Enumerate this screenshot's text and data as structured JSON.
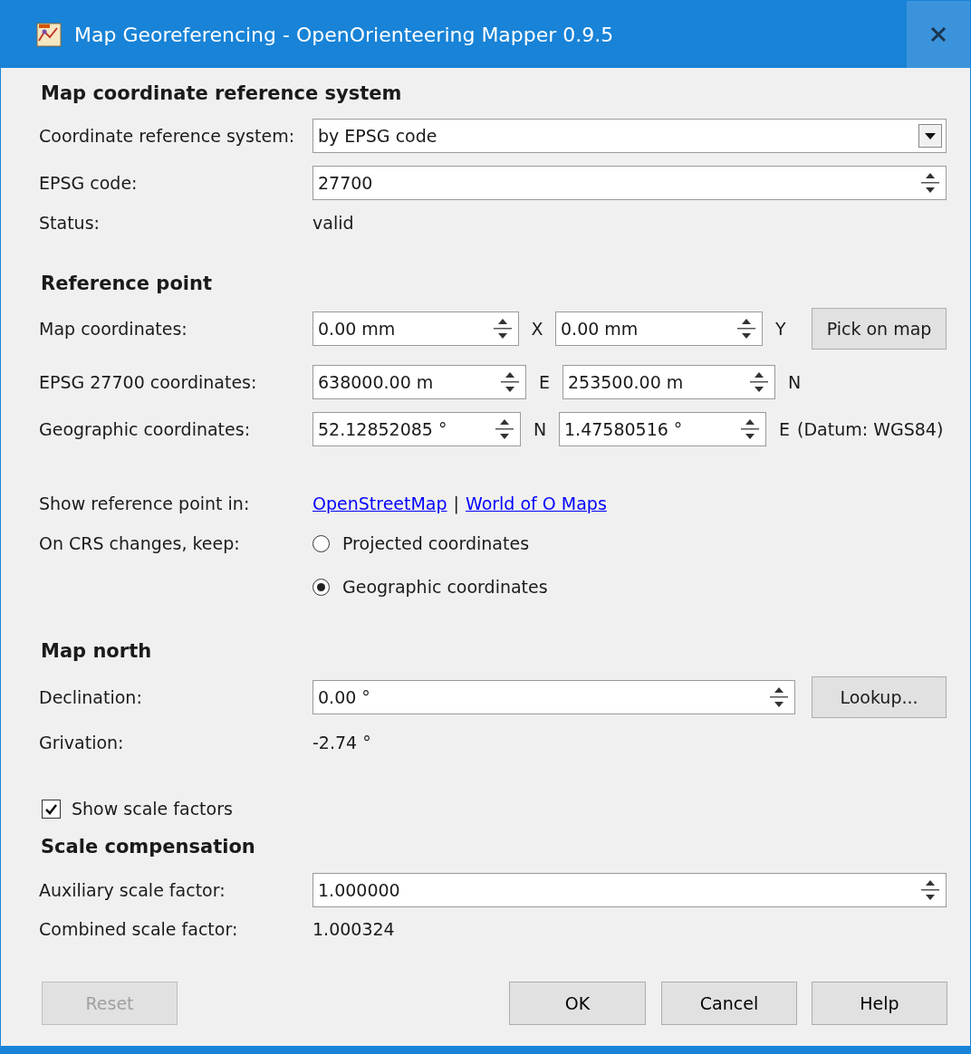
{
  "window": {
    "title": "Map Georeferencing - OpenOrienteering Mapper 0.9.5"
  },
  "crs_section": {
    "heading": "Map coordinate reference system",
    "crs_label": "Coordinate reference system:",
    "crs_value": "by EPSG code",
    "epsg_label": "EPSG code:",
    "epsg_value": "27700",
    "status_label": "Status:",
    "status_value": "valid"
  },
  "reference_point": {
    "heading": "Reference point",
    "map_coords": {
      "label": "Map coordinates:",
      "x": "0.00 mm",
      "x_unit": "X",
      "y": "0.00 mm",
      "y_unit": "Y",
      "button": "Pick on map"
    },
    "projected": {
      "label": "EPSG 27700 coordinates:",
      "e": "638000.00 m",
      "e_unit": "E",
      "n": "253500.00 m",
      "n_unit": "N"
    },
    "geographic": {
      "label": "Geographic coordinates:",
      "lat": "52.12852085 °",
      "lat_unit": "N",
      "lon": "1.47580516 °",
      "lon_unit": "E",
      "datum": "(Datum: WGS84)"
    },
    "show_in": {
      "label": "Show reference point in:",
      "links": [
        "OpenStreetMap",
        "World of O Maps"
      ],
      "separator": "|"
    },
    "keep": {
      "label": "On CRS changes, keep:",
      "options": [
        {
          "label": "Projected coordinates",
          "selected": false
        },
        {
          "label": "Geographic coordinates",
          "selected": true
        }
      ]
    }
  },
  "map_north": {
    "heading": "Map north",
    "declination_label": "Declination:",
    "declination_value": "0.00 °",
    "lookup_button": "Lookup...",
    "grivation_label": "Grivation:",
    "grivation_value": "-2.74 °"
  },
  "show_scale_factors": {
    "label": "Show scale factors",
    "checked": true
  },
  "scale": {
    "heading": "Scale compensation",
    "aux_label": "Auxiliary scale factor:",
    "aux_value": "1.000000",
    "combined_label": "Combined scale factor:",
    "combined_value": "1.000324"
  },
  "buttons": [
    {
      "label": "Reset",
      "disabled": true
    },
    {
      "label": "OK",
      "disabled": false
    },
    {
      "label": "Cancel",
      "disabled": false
    },
    {
      "label": "Help",
      "disabled": false
    }
  ]
}
